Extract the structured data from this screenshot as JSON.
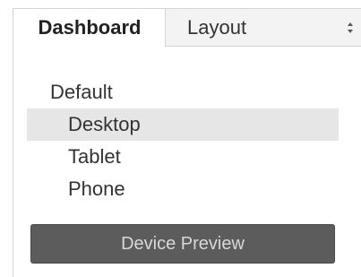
{
  "tabs": {
    "dashboard_label": "Dashboard",
    "layout_label": "Layout"
  },
  "device_layouts": {
    "items": [
      {
        "label": "Default",
        "level": "group",
        "selected": false
      },
      {
        "label": "Desktop",
        "level": "child",
        "selected": true
      },
      {
        "label": "Tablet",
        "level": "child",
        "selected": false
      },
      {
        "label": "Phone",
        "level": "child",
        "selected": false
      }
    ]
  },
  "device_preview": {
    "label": "Device Preview"
  },
  "colors": {
    "selected_row": "#e6e6e6",
    "button_bg": "#5c5c5c",
    "button_text": "#d8d8d8"
  }
}
